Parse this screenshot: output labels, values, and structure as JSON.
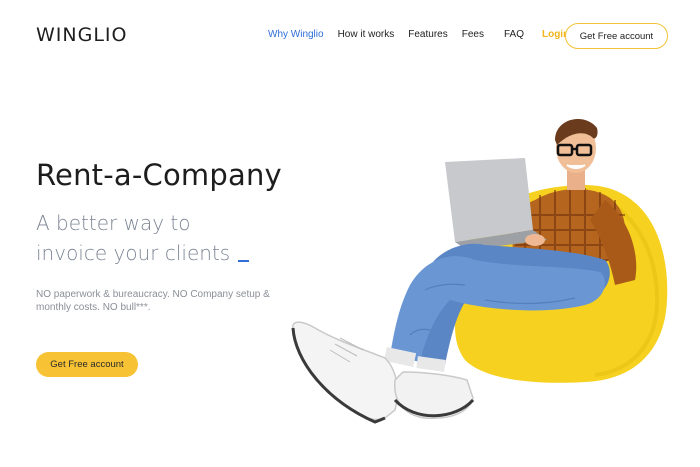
{
  "brand": {
    "logo": "WINGLIO"
  },
  "nav": {
    "links": [
      "Why Winglio",
      "How it works",
      "Features",
      "Fees",
      "FAQ"
    ],
    "active": "Why Winglio",
    "login": "Login",
    "cta": "Get Free account"
  },
  "hero": {
    "title": "Rent-a-Company",
    "subtitle_line1": "A better way to",
    "subtitle_line2": "invoice your clients",
    "description": "NO paperwork & bureaucracy. NO Company setup & monthly costs. NO bull***.",
    "cta": "Get Free account"
  },
  "colors": {
    "accent": "#f7c233",
    "link_active": "#2f6fd6",
    "text_muted": "#7d8694"
  },
  "illustration": {
    "icon": "man-with-laptop-on-beanbag-illustration"
  }
}
